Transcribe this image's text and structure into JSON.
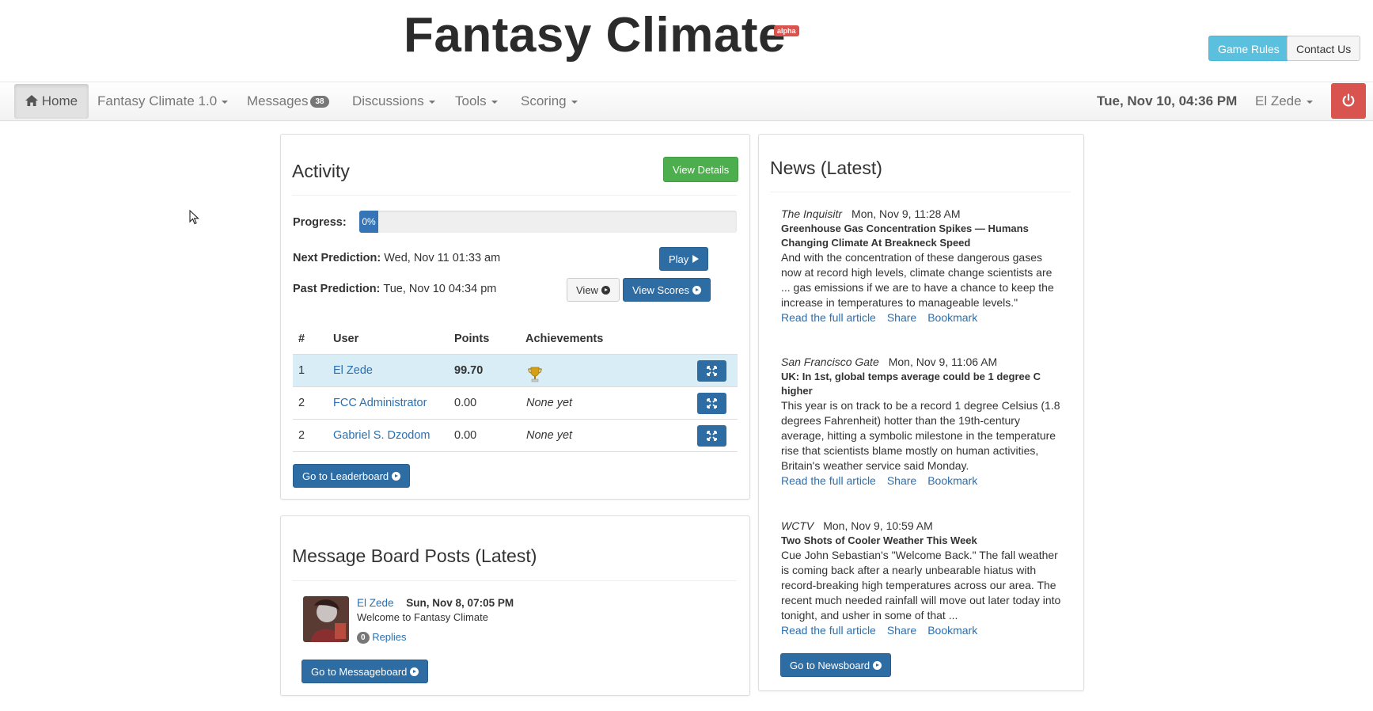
{
  "header": {
    "title": "Fantasy Climate",
    "badge": "alpha",
    "game_rules": "Game Rules",
    "contact_us": "Contact Us"
  },
  "nav": {
    "home": "Home",
    "fantasy_climate": "Fantasy Climate 1.0",
    "messages": "Messages",
    "messages_count": "38",
    "discussions": "Discussions",
    "tools": "Tools",
    "scoring": "Scoring",
    "datetime": "Tue, Nov 10, 04:36 PM",
    "user": "El Zede"
  },
  "activity": {
    "title": "Activity",
    "view_details": "View Details",
    "progress_label": "Progress:",
    "progress_text": "0%",
    "progress_value": 0,
    "next_label": "Next Prediction:",
    "next_value": "Wed, Nov 11 01:33 am",
    "past_label": "Past Prediction:",
    "past_value": "Tue, Nov 10 04:34 pm",
    "play": "Play",
    "view": "View",
    "view_scores": "View Scores",
    "columns": [
      "#",
      "User",
      "Points",
      "Achievements"
    ],
    "rows": [
      {
        "rank": "1",
        "user": "El Zede",
        "points": "99.70",
        "achievements": ""
      },
      {
        "rank": "2",
        "user": "FCC Administrator",
        "points": "0.00",
        "achievements": "None yet"
      },
      {
        "rank": "2",
        "user": "Gabriel S. Dzodom",
        "points": "0.00",
        "achievements": "None yet"
      }
    ],
    "leaderboard_button": "Go to Leaderboard"
  },
  "messages": {
    "title": "Message Board Posts (Latest)",
    "post": {
      "author": "El Zede",
      "date": "Sun, Nov 8, 07:05 PM",
      "text": "Welcome to Fantasy Climate",
      "reply_count": "0",
      "replies_label": "Replies"
    },
    "messageboard_button": "Go to Messageboard"
  },
  "news": {
    "title": "News (Latest)",
    "links": {
      "read": "Read the full article",
      "share": "Share",
      "bookmark": "Bookmark"
    },
    "items": [
      {
        "source": "The Inquisitr",
        "date": "Mon, Nov 9, 11:28 AM",
        "headline": "Greenhouse Gas Concentration Spikes — Humans Changing Climate At Breakneck Speed",
        "body": "And with the concentration of these dangerous gases now at record high levels, climate change scientists are ... gas emissions if we are to have a chance to keep the increase in temperatures to manageable levels.\""
      },
      {
        "source": "San Francisco Gate",
        "date": "Mon, Nov 9, 11:06 AM",
        "headline": "UK: In 1st, global temps average could be 1 degree C higher",
        "body": "This year is on track to be a record 1 degree Celsius (1.8 degrees Fahrenheit) hotter than the 19th-century average, hitting a symbolic milestone in the temperature rise that scientists blame mostly on human activities, Britain's weather service said Monday."
      },
      {
        "source": "WCTV",
        "date": "Mon, Nov 9, 10:59 AM",
        "headline": "Two Shots of Cooler Weather This Week",
        "body": "Cue John Sebastian's \"Welcome Back.\" The fall weather is coming back after a nearly unbearable hiatus with record-breaking high temperatures across our area. The recent much needed rainfall will move out later today into tonight, and usher in some of that ..."
      }
    ],
    "newsboard_button": "Go to Newsboard"
  },
  "colors": {
    "primary": "#2e6da4",
    "info": "#5bc0de",
    "success": "#4cae4c",
    "danger": "#d9534f",
    "row_highlight": "#d9edf7"
  },
  "icons": {
    "home": "home-icon",
    "power": "power-icon",
    "trophy": "trophy-icon",
    "expand": "expand-icon",
    "play": "play-icon",
    "arrow": "circle-arrow-right-icon"
  }
}
